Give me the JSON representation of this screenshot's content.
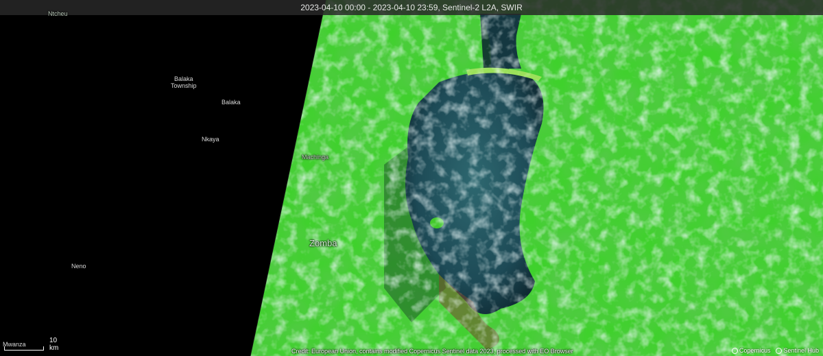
{
  "header": {
    "title": "2023-04-10 00:00 - 2023-04-10 23:59, Sentinel-2 L2A, SWIR"
  },
  "places": [
    {
      "name": "Ntcheu",
      "style": "dim"
    },
    {
      "name": "Balaka\nTownship",
      "style": "normal"
    },
    {
      "name": "Balaka",
      "style": "normal"
    },
    {
      "name": "Nkaya",
      "style": "normal"
    },
    {
      "name": "Neno",
      "style": "normal"
    },
    {
      "name": "Mwanza",
      "style": "normal"
    },
    {
      "name": "Machinga",
      "style": "dim"
    },
    {
      "name": "Zomba",
      "style": "big"
    }
  ],
  "scale": {
    "label": "10 km"
  },
  "credit": "Credit: European Union, contains modified Copernicus Sentinel data 2023, processed with EO Browser",
  "logos": [
    {
      "label": "Copernicus",
      "icon": "copernicus-icon"
    },
    {
      "label": "Sentinel Hub",
      "icon": "sentinelhub-icon"
    }
  ],
  "colors": {
    "no_data": "#000000",
    "vegetation": "#3fd12c",
    "lake_water": "#1f4f5a",
    "clouds": "#e6f4f4",
    "header_bg": "#282828"
  }
}
